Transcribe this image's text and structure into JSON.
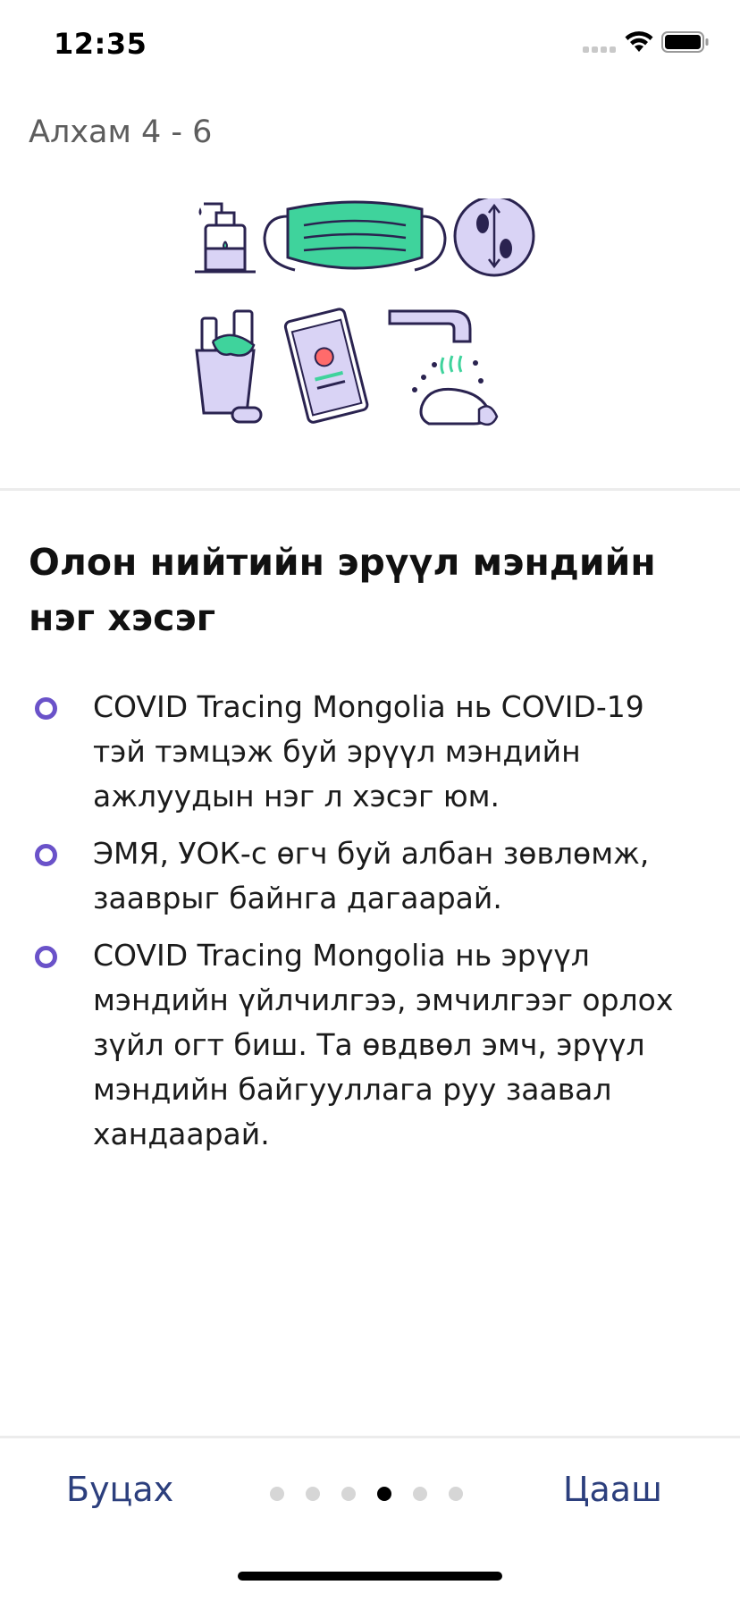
{
  "status_bar": {
    "time": "12:35"
  },
  "header": {
    "step_label": "Алхам 4  -  6"
  },
  "content": {
    "title": "Олон нийтийн эрүүл мэндийн нэг хэсэг",
    "bullets": [
      "COVID Tracing Mongolia нь COVID-19 тэй тэмцэж буй эрүүл мэндийн ажлуудын нэг л хэсэг юм.",
      "ЭМЯ, УОК-с өгч буй албан зөвлөмж, зааврыг байнга дагаарай.",
      "COVID Tracing Mongolia нь эрүүл мэндийн үйлчилгээ, эмчилгээг орлох зүйл огт биш. Та өвдвөл эмч, эрүүл мэндийн байгууллага руу заавал хандаарай."
    ]
  },
  "footer": {
    "back_label": "Буцах",
    "next_label": "Цааш",
    "page_count": 6,
    "current_page": 4
  },
  "colors": {
    "accent": "#6a52c9",
    "nav_text": "#2c3f7d",
    "mask_green": "#3fd39c"
  },
  "icons": [
    "hand-sanitizer-icon",
    "face-mask-icon",
    "social-distance-icon",
    "cleaning-bucket-icon",
    "phone-alert-icon",
    "hand-washing-icon"
  ]
}
